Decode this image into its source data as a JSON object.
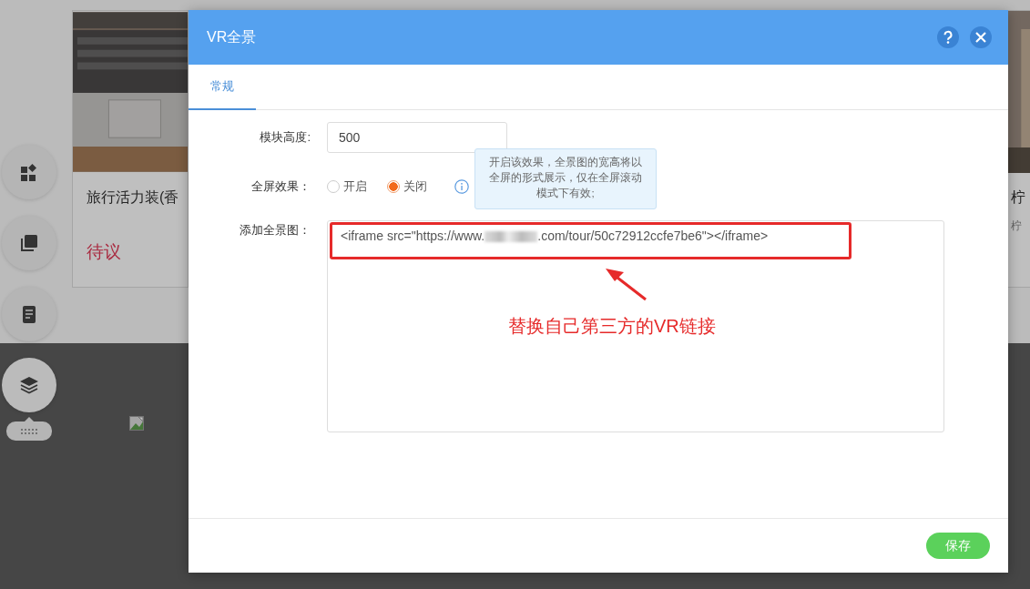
{
  "background": {
    "cards": [
      {
        "kind": "product",
        "title": "旅行活力装(香",
        "status": "待议"
      },
      {
        "kind": "partial",
        "title": "柠",
        "subtitle": "柠"
      }
    ]
  },
  "dialog": {
    "title": "VR全景",
    "tabs": [
      {
        "label": "常规",
        "selected": true
      }
    ],
    "fields": [
      {
        "kind": "input",
        "label": "模块高度:",
        "value": "500"
      },
      {
        "kind": "radio",
        "label": "全屏效果：",
        "options": [
          {
            "label": "开启",
            "selected": false
          },
          {
            "label": "关闭",
            "selected": true
          }
        ],
        "tooltip": "开启该效果，全景图的宽高将以全屏的形式展示，仅在全屏滚动模式下有效;"
      },
      {
        "kind": "textarea",
        "label": "添加全景图：",
        "value_start": "<iframe src=\"https://www.",
        "value_end": ".com/tour/50c72912ccfe7be6\"></iframe>"
      }
    ],
    "annotation": "替换自己第三方的VR链接",
    "buttons": [
      "保存"
    ]
  }
}
